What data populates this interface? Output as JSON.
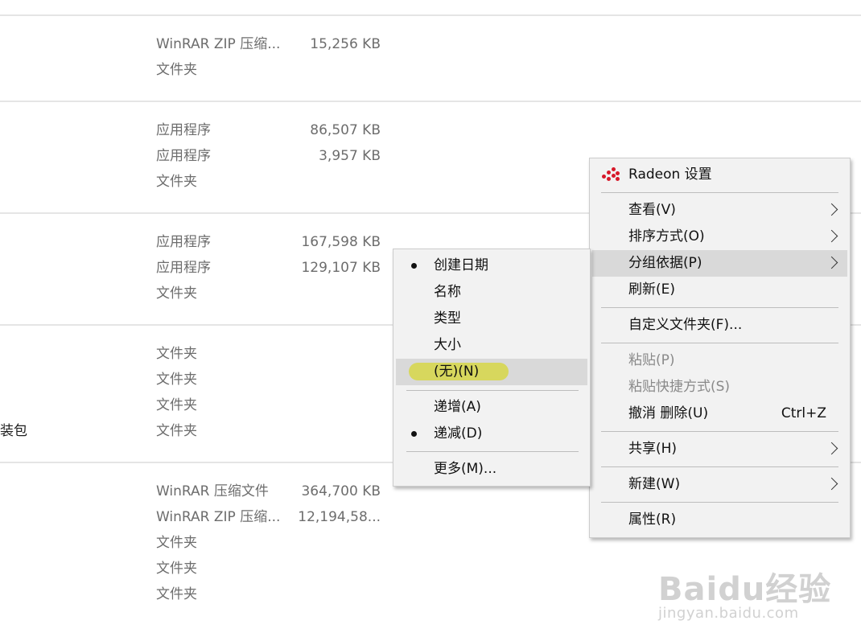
{
  "file_list": {
    "groups": [
      {
        "rows": [
          {
            "name": "",
            "type": "WinRAR ZIP 压缩...",
            "size": "15,256 KB"
          },
          {
            "name": "",
            "type": "文件夹",
            "size": ""
          }
        ]
      },
      {
        "rows": [
          {
            "name": "",
            "type": "应用程序",
            "size": "86,507 KB"
          },
          {
            "name": "",
            "type": "应用程序",
            "size": "3,957 KB"
          },
          {
            "name": "",
            "type": "文件夹",
            "size": ""
          }
        ]
      },
      {
        "rows": [
          {
            "name": "",
            "type": "应用程序",
            "size": "167,598 KB"
          },
          {
            "name": "",
            "type": "应用程序",
            "size": "129,107 KB"
          },
          {
            "name": "",
            "type": "文件夹",
            "size": ""
          }
        ]
      },
      {
        "rows": [
          {
            "name": "",
            "type": "文件夹",
            "size": ""
          },
          {
            "name": "",
            "type": "文件夹",
            "size": ""
          },
          {
            "name": "",
            "type": "文件夹",
            "size": ""
          },
          {
            "name": "装包",
            "type": "文件夹",
            "size": ""
          }
        ]
      },
      {
        "rows": [
          {
            "name": "",
            "type": "WinRAR 压缩文件",
            "size": "364,700 KB"
          },
          {
            "name": "",
            "type": "WinRAR ZIP 压缩...",
            "size": "12,194,58..."
          },
          {
            "name": "",
            "type": "文件夹",
            "size": ""
          },
          {
            "name": "",
            "type": "文件夹",
            "size": ""
          },
          {
            "name": "",
            "type": "文件夹",
            "size": ""
          }
        ]
      }
    ]
  },
  "context_menu": {
    "radeon": "Radeon 设置",
    "view": "查看(V)",
    "sort_by": "排序方式(O)",
    "group_by": "分组依据(P)",
    "refresh": "刷新(E)",
    "customize": "自定义文件夹(F)...",
    "paste": "粘贴(P)",
    "paste_shortcut": "粘贴快捷方式(S)",
    "undo_delete": "撤消 删除(U)",
    "undo_shortcut": "Ctrl+Z",
    "share": "共享(H)",
    "new": "新建(W)",
    "properties": "属性(R)"
  },
  "group_submenu": {
    "created_date": "创建日期",
    "name": "名称",
    "type": "类型",
    "size": "大小",
    "none": "(无)(N)",
    "ascending": "递增(A)",
    "descending": "递减(D)",
    "more": "更多(M)..."
  },
  "watermark": {
    "logo": "Baidu经验",
    "url": "jingyan.baidu.com"
  },
  "colors": {
    "menu_bg": "#f2f2f2",
    "highlight": "#d9d9d9",
    "marker": "#d6d64f",
    "radeon_red": "#d7192a"
  }
}
